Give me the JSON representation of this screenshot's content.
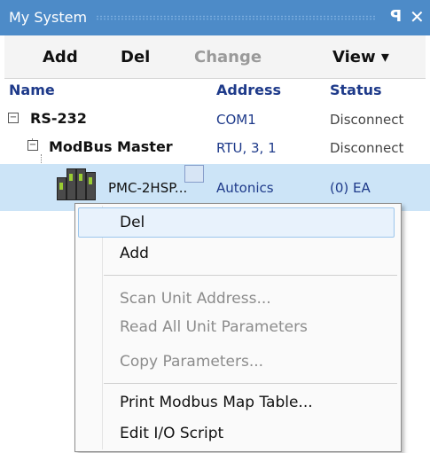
{
  "panel": {
    "title": "My System",
    "pin_glyph": "ꟼ",
    "close_glyph": "✕"
  },
  "toolbar": {
    "add": "Add",
    "del": "Del",
    "change": "Change",
    "view": "View ▾"
  },
  "columns": {
    "name": "Name",
    "address": "Address",
    "status": "Status"
  },
  "tree": [
    {
      "name": "RS-232",
      "address": "COM1",
      "status": "Disconnect",
      "expander": "−"
    },
    {
      "name": "ModBus Master",
      "address": "RTU, 3, 1",
      "status": "Disconnect",
      "expander": "−"
    },
    {
      "name": "PMC-2HSP...",
      "address": "Autonics",
      "status": "(0) EA",
      "icon": "plc-device-icon"
    }
  ],
  "context_menu": {
    "items": [
      {
        "label": "Del",
        "enabled": true,
        "highlighted": true
      },
      {
        "label": "Add",
        "enabled": true
      },
      {
        "label": "Scan Unit Address...",
        "enabled": false
      },
      {
        "label": "Read All Unit Parameters",
        "enabled": false
      },
      {
        "label": "Copy Parameters...",
        "enabled": false
      },
      {
        "label": "Print Modbus Map Table...",
        "enabled": true
      },
      {
        "label": "Edit I/O Script",
        "enabled": true
      }
    ]
  },
  "colors": {
    "title_bar": "#4d8bc8",
    "selected_row": "#cce4f7",
    "header_text": "#1e3a8a"
  }
}
